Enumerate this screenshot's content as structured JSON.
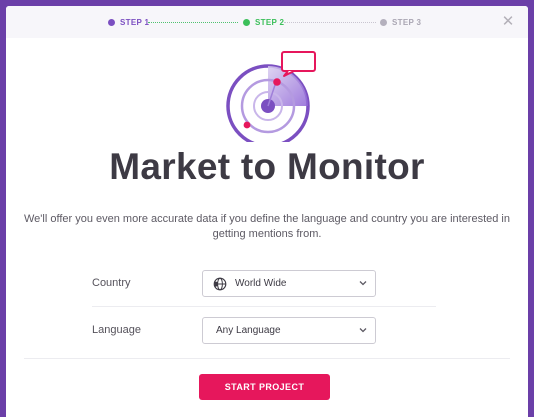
{
  "steps": [
    {
      "label": "STEP 1",
      "color": "#7b4fc1"
    },
    {
      "label": "STEP 2",
      "color": "#3cbf5a"
    },
    {
      "label": "STEP 3",
      "color": "#b4b0bd"
    }
  ],
  "close_icon": "close-icon",
  "illustration_icon": "radar-monitor-icon",
  "title": "Market to Monitor",
  "description": "We'll offer you even more accurate data if you define the language and country you are interested in getting mentions from.",
  "country": {
    "label": "Country",
    "value": "World Wide",
    "icon": "globe-icon"
  },
  "language": {
    "label": "Language",
    "value": "Any Language"
  },
  "start_button": {
    "label": "START PROJECT",
    "color": "#e6175c"
  }
}
